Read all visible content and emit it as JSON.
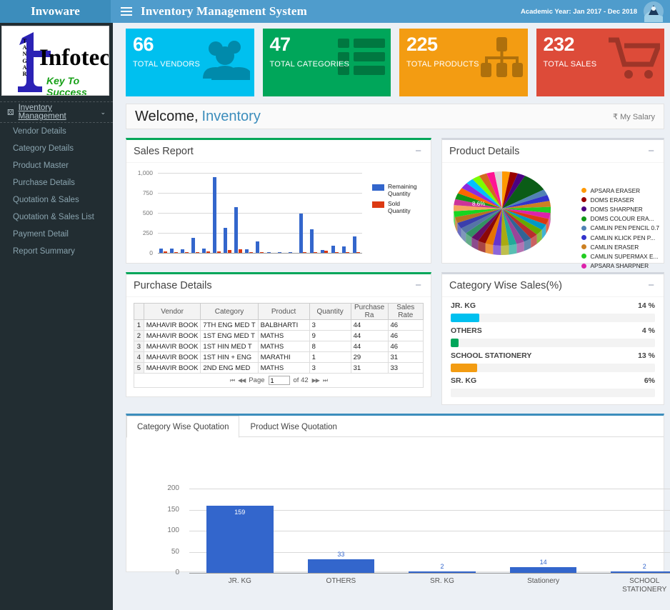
{
  "header": {
    "brand": "Invoware",
    "system_title": "Inventory Management System",
    "academic_year": "Academic Year: Jan 2017 - Dec 2018",
    "hamburger_icon": "hamburger-icon",
    "avatar_icon": "user-avatar-icon"
  },
  "logo": {
    "mark": "1",
    "vertical_text": "TANGAR",
    "name": "Infotech",
    "tagline": "Key To Success"
  },
  "sidebar": {
    "menu_header": "Inventory Management",
    "menu_header_icon": "inventory-icon",
    "chevron": "⌄",
    "items": [
      {
        "label": "Vendor Details"
      },
      {
        "label": "Category Details"
      },
      {
        "label": "Product Master"
      },
      {
        "label": "Purchase Details"
      },
      {
        "label": "Quotation & Sales"
      },
      {
        "label": "Quotation & Sales List"
      },
      {
        "label": "Payment Detail"
      },
      {
        "label": "Report Summary"
      }
    ]
  },
  "cards": [
    {
      "value": "66",
      "label": "TOTAL VENDORS",
      "color": "#00c0ef",
      "icon": "users-icon"
    },
    {
      "value": "47",
      "label": "TOTAL CATEGORIES",
      "color": "#00a65a",
      "icon": "grid-list-icon"
    },
    {
      "value": "225",
      "label": "TOTAL PRODUCTS",
      "color": "#f39c12",
      "icon": "sitemap-icon"
    },
    {
      "value": "232",
      "label": "TOTAL SALES",
      "color": "#dd4b39",
      "icon": "shopping-cart-icon"
    }
  ],
  "welcome": {
    "greeting": "Welcome,",
    "user": "Inventory",
    "salary_label": "₹ My Salary"
  },
  "panels": {
    "sales_report": {
      "title": "Sales Report",
      "minimize": "−",
      "accent": "#00a65a"
    },
    "product_details": {
      "title": "Product Details",
      "minimize": "−",
      "accent": "#d2d6de"
    },
    "purchase_details": {
      "title": "Purchase Details",
      "minimize": "−",
      "accent": "#00a65a"
    },
    "category_sales": {
      "title": "Category Wise Sales(%)",
      "minimize": "−",
      "accent": "#d2d6de"
    }
  },
  "chart_data": [
    {
      "type": "bar",
      "title": "Sales Report",
      "xlabel": "",
      "ylabel": "",
      "ylim": [
        0,
        1000
      ],
      "yticks": [
        "0",
        "250",
        "500",
        "750",
        "1,000"
      ],
      "grid": true,
      "legend_position": "right",
      "series": [
        {
          "name": "Remaining Quantity",
          "color": "#3366cc",
          "values": [
            55,
            52,
            48,
            192,
            50,
            948,
            312,
            568,
            45,
            143,
            5,
            6,
            4,
            495,
            292,
            38,
            88,
            82,
            202
          ]
        },
        {
          "name": "Sold Quantity",
          "color": "#dc3912",
          "values": [
            14,
            10,
            4,
            2,
            16,
            18,
            38,
            45,
            2,
            1,
            0,
            0,
            0,
            2,
            4,
            26,
            6,
            8,
            1
          ]
        }
      ]
    },
    {
      "type": "pie",
      "title": "Product Details",
      "slice_label": "8.6%",
      "legend_position": "right",
      "legend": [
        {
          "label": "APSARA ERASER",
          "color": "#ff9900"
        },
        {
          "label": "DOMS ERASER",
          "color": "#990000"
        },
        {
          "label": "DOMS SHARPNER",
          "color": "#4b0082"
        },
        {
          "label": "DOMS COLOUR ERA...",
          "color": "#109618"
        },
        {
          "label": "CAMLIN PEN PENCIL 0.7",
          "color": "#5182b5"
        },
        {
          "label": "CAMLIN KLICK PEN P...",
          "color": "#3333cc"
        },
        {
          "label": "CAMLIN ERASER",
          "color": "#cc8022"
        },
        {
          "label": "CAMLIN SUPERMAX E...",
          "color": "#22cc22"
        },
        {
          "label": "APSARA SHARPNER",
          "color": "#dd22aa"
        }
      ]
    },
    {
      "type": "bar",
      "title": "Category Wise Quotation",
      "categories": [
        "JR. KG",
        "OTHERS",
        "SR. KG",
        "Stationery",
        "SCHOOL STATIONERY"
      ],
      "values": [
        159,
        33,
        2,
        14,
        2
      ],
      "data_labels": [
        "159",
        "33",
        "2",
        "14",
        "2"
      ],
      "ylim": [
        0,
        200
      ],
      "yticks": [
        "0",
        "50",
        "100",
        "150",
        "200"
      ],
      "color": "#3366cc",
      "grid": true
    }
  ],
  "purchase_table": {
    "columns": [
      "",
      "Vendor",
      "Category",
      "Product",
      "Quantity",
      "Purchase Ra",
      "Sales Rate"
    ],
    "rows": [
      [
        "1",
        "MAHAVIR BOOK",
        "7TH ENG MED T",
        "BALBHARTI",
        "3",
        "44",
        "46"
      ],
      [
        "2",
        "MAHAVIR BOOK",
        "1ST ENG MED T",
        "MATHS",
        "9",
        "44",
        "46"
      ],
      [
        "3",
        "MAHAVIR BOOK",
        "1ST HIN MED T",
        "MATHS",
        "8",
        "44",
        "46"
      ],
      [
        "4",
        "MAHAVIR BOOK",
        "1ST HIN + ENG",
        "MARATHI",
        "1",
        "29",
        "31"
      ],
      [
        "5",
        "MAHAVIR BOOK",
        "2ND ENG MED ",
        "MATHS",
        "3",
        "31",
        "33"
      ]
    ],
    "pager": {
      "first": "⏮",
      "prev": "◀◀",
      "page_word": "Page",
      "page_value": "1",
      "of_text": "of 42",
      "next": "▶▶",
      "last": "⏭"
    }
  },
  "category_sales": [
    {
      "label": "JR. KG",
      "pct_text": "14 %",
      "pct": 14,
      "color": "#00c0ef"
    },
    {
      "label": "OTHERS",
      "pct_text": "4 %",
      "pct": 4,
      "color": "#00a65a"
    },
    {
      "label": "SCHOOL STATIONERY",
      "pct_text": "13 %",
      "pct": 13,
      "color": "#f39c12"
    },
    {
      "label": "SR. KG",
      "pct_text": "6%",
      "pct": 0,
      "color": "#dd4b39"
    }
  ],
  "tabs": [
    {
      "label": "Category Wise Quotation",
      "active": true
    },
    {
      "label": "Product Wise Quotation",
      "active": false
    }
  ]
}
